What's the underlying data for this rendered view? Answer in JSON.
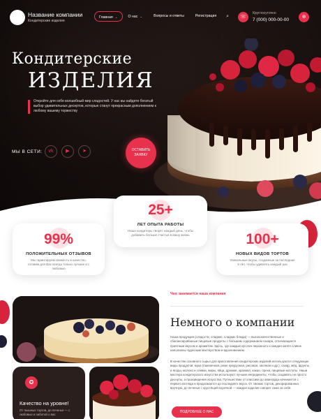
{
  "header": {
    "company_name": "Название компании",
    "company_sub": "Кондитерские изделия",
    "nav": [
      {
        "label": "Главная",
        "dropdown": true,
        "active": true
      },
      {
        "label": "О нас",
        "dropdown": true,
        "active": false
      },
      {
        "label": "Вопросы и ответы",
        "dropdown": false,
        "active": false
      },
      {
        "label": "Регистрация",
        "dropdown": false,
        "active": false
      }
    ],
    "phone_label": "Круглосуточно",
    "phone_number": "7 (000) 000-00-00"
  },
  "hero": {
    "title_line1": "Кондитерские",
    "title_line2": "ИЗДЕЛИЯ",
    "description": "Откройте для себя волшебный мир сладостей. У нас вы найдете богатый выбор удивительных десертов, которые станут прекрасным дополнением к любому вашему торжеству",
    "social_label": "МЫ В СЕТИ:",
    "social_icons": [
      "vk-icon",
      "youtube-icon",
      "telegram-icon"
    ],
    "cta_label_line1": "ОСТАВИТЬ",
    "cta_label_line2": "ЗАЯВКУ"
  },
  "stats": [
    {
      "number": "99%",
      "title": "ПОЛОЖИТЕЛЬНЫХ ОТЗЫВОВ",
      "text": "Мы гарантируем свежесть и качество, готовим для Вас всегда только лучшее и с любовью"
    },
    {
      "number": "25+",
      "title": "ЛЕТ ОПЫТА РАБОТЫ",
      "text": "Наши кондитеры творят каждый день, чтобы добавить больше счастья в вашу жизнь"
    },
    {
      "number": "100+",
      "title": "НОВЫХ ВИДОВ ТОРТОВ",
      "text": "Уникальные вкусы, созданные за последние 5 лет, чтобы удивлять каждый раз"
    }
  ],
  "about": {
    "kicker": "Чем занимается наша компания",
    "title": "Немного о компании",
    "p1": "Наша продукция (сладости, сладкие, сладкие блюда) — высококачественные и сбалансированные пищевые продукты с большим содержанием сахара, отличающиеся приятным вкусом и ароматом. Здесь, где каждый кусочек пирожного и каждая капля сливок наполнены чудесным мастерством и вдохновением.",
    "p2": "В качестве основного сырья для приготовления кондитерских изделий используются следующие виды продуктов: мука (пшеничная, реже кукурузная, рисовая, овсяная и др.), сахар, мёд, фрукты и ягоды, молоко и сливки, жиры, яйца, дрожжи, крахмал, какао, орехи, пищевые кислоты. Наши мастера кондитерского искусства используют лучшие ингредиенты, чтобы создавать не просто десерты, а произведения искусства. Путешествие от классики до авангарда начинается с первого взгляда и продолжается до последнего вкуса. От свежих тортов, декорированных вручную, до печенья с хрустящей корочкой — каждое изделие говорит само за себя.",
    "button_label": "ПОДРОБНЕЕ О НАС",
    "quality_title": "Качество на уровне!",
    "quality_text": "От пышных тортов, до печенья — с любовью и заботой о вас"
  },
  "colors": {
    "accent": "#e8314c",
    "hero_bg": "#1f1513"
  }
}
